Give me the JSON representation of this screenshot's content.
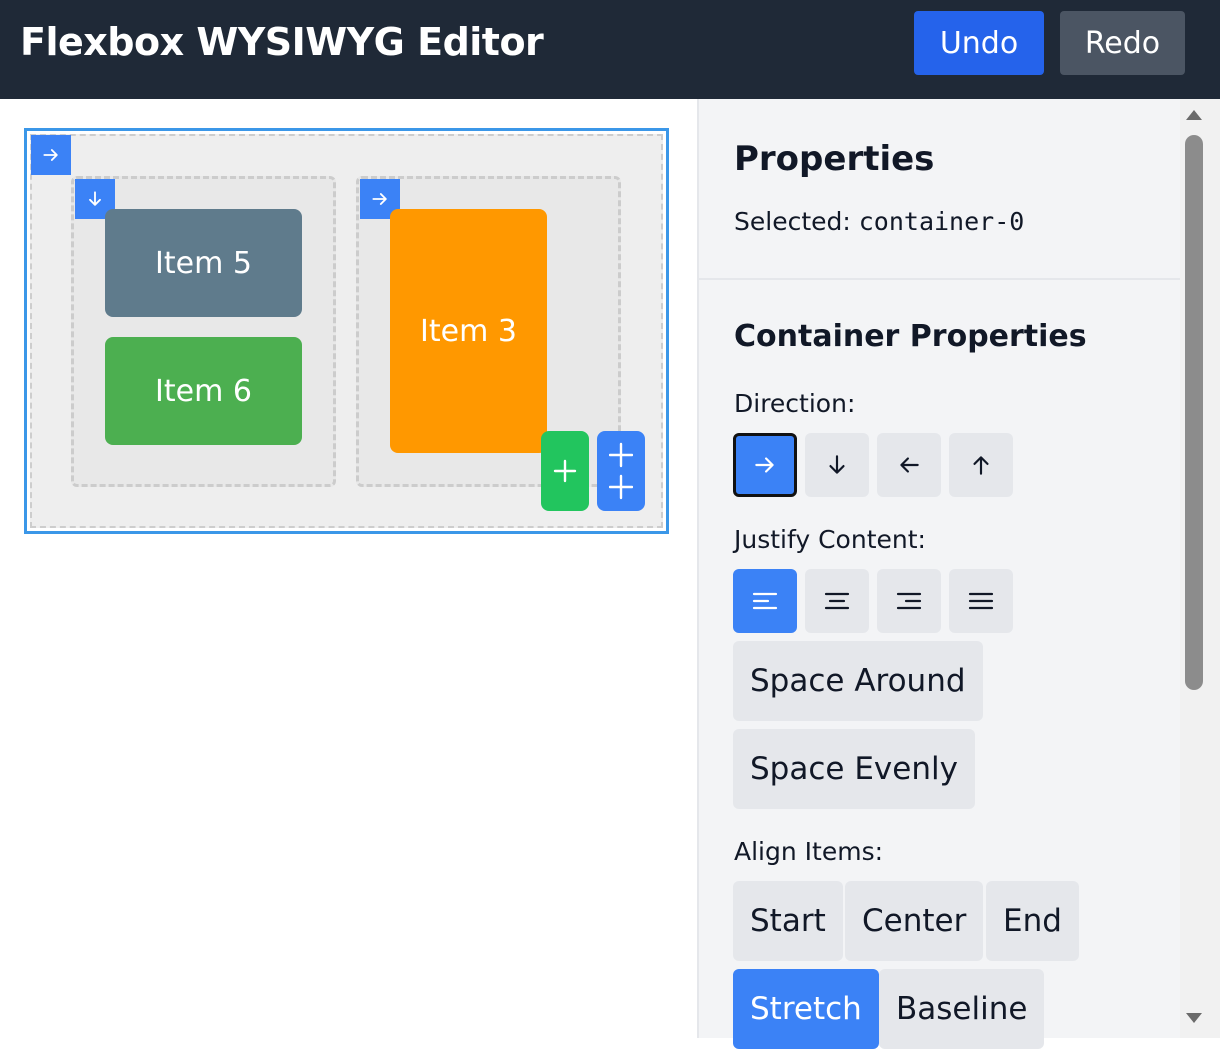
{
  "header": {
    "title": "Flexbox WYSIWYG Editor",
    "undo_label": "Undo",
    "redo_label": "Redo",
    "colors": {
      "background": "#1f2937",
      "undo": "#2563eb",
      "redo": "#4b5563"
    }
  },
  "canvas": {
    "root_container": {
      "direction_icon": "arrow-right-icon",
      "selected": true
    },
    "containers": [
      {
        "direction_icon": "arrow-down-icon",
        "items": [
          "Item 5",
          "Item 6"
        ]
      },
      {
        "direction_icon": "arrow-right-icon",
        "items": [
          "Item 3"
        ]
      }
    ],
    "item_colors": {
      "Item 5": "#5f7b8c",
      "Item 6": "#4caf50",
      "Item 3": "#ff9800"
    },
    "add_child_icon": "plus-icon",
    "add_sibling_icon": "double-plus-icon"
  },
  "panel": {
    "title": "Properties",
    "selected_label": "Selected:",
    "selected_value": "container-0",
    "section_title": "Container Properties",
    "direction": {
      "label": "Direction:",
      "options": [
        {
          "icon": "arrow-right-icon",
          "active": true
        },
        {
          "icon": "arrow-down-icon",
          "active": false
        },
        {
          "icon": "arrow-left-icon",
          "active": false
        },
        {
          "icon": "arrow-up-icon",
          "active": false
        }
      ]
    },
    "justify": {
      "label": "Justify Content:",
      "options": [
        {
          "icon": "align-left-icon",
          "active": true
        },
        {
          "icon": "align-center-icon",
          "active": false
        },
        {
          "icon": "align-right-icon",
          "active": false
        },
        {
          "icon": "space-between-icon",
          "active": false
        }
      ],
      "text_options": [
        "Space Around",
        "Space Evenly"
      ]
    },
    "align": {
      "label": "Align Items:",
      "options": [
        "Start",
        "Center",
        "End",
        "Stretch",
        "Baseline"
      ],
      "active": "Stretch"
    },
    "accent_color": "#3b82f6"
  }
}
